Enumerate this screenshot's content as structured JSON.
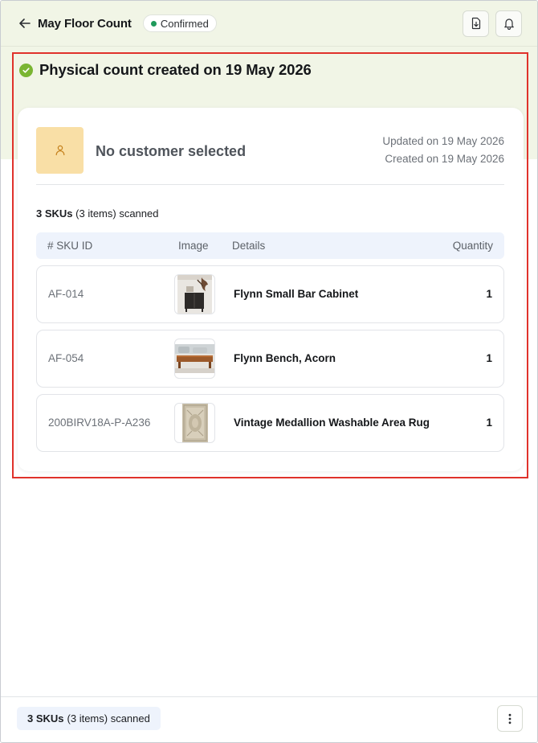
{
  "header": {
    "title": "May Floor Count",
    "status": "Confirmed",
    "status_color": "#1f9a5b",
    "back_icon": "arrow-left-icon",
    "actions": [
      {
        "icon": "download-file-icon"
      },
      {
        "icon": "bell-icon"
      }
    ]
  },
  "banner": {
    "heading": "Physical count created on 19 May 2026",
    "icon": "check-circle-icon",
    "icon_color": "#7ab532"
  },
  "customer": {
    "name": "No customer selected",
    "avatar_icon": "user-icon",
    "updated": "Updated on 19 May 2026",
    "created": "Created on 19 May 2026"
  },
  "summary": {
    "count": "3 SKUs",
    "rest": "(3 items) scanned"
  },
  "table": {
    "headers": {
      "sku": "# SKU ID",
      "image": "Image",
      "details": "Details",
      "quantity": "Quantity"
    },
    "rows": [
      {
        "sku": "AF-014",
        "details": "Flynn Small Bar Cabinet",
        "quantity": "1",
        "image": "cabinet-thumbnail"
      },
      {
        "sku": "AF-054",
        "details": "Flynn Bench, Acorn",
        "quantity": "1",
        "image": "bench-thumbnail"
      },
      {
        "sku": "200BIRV18A-P-A236",
        "details": "Vintage Medallion Washable Area Rug",
        "quantity": "1",
        "image": "rug-thumbnail"
      }
    ]
  },
  "footer": {
    "count": "3 SKUs",
    "rest": "(3 items) scanned",
    "more_icon": "more-vertical-icon"
  },
  "colors": {
    "accent_band": "#f1f5e6",
    "highlight_border": "#e0322b",
    "table_header_bg": "#eef3fc",
    "avatar_bg": "#f9dfa6"
  }
}
